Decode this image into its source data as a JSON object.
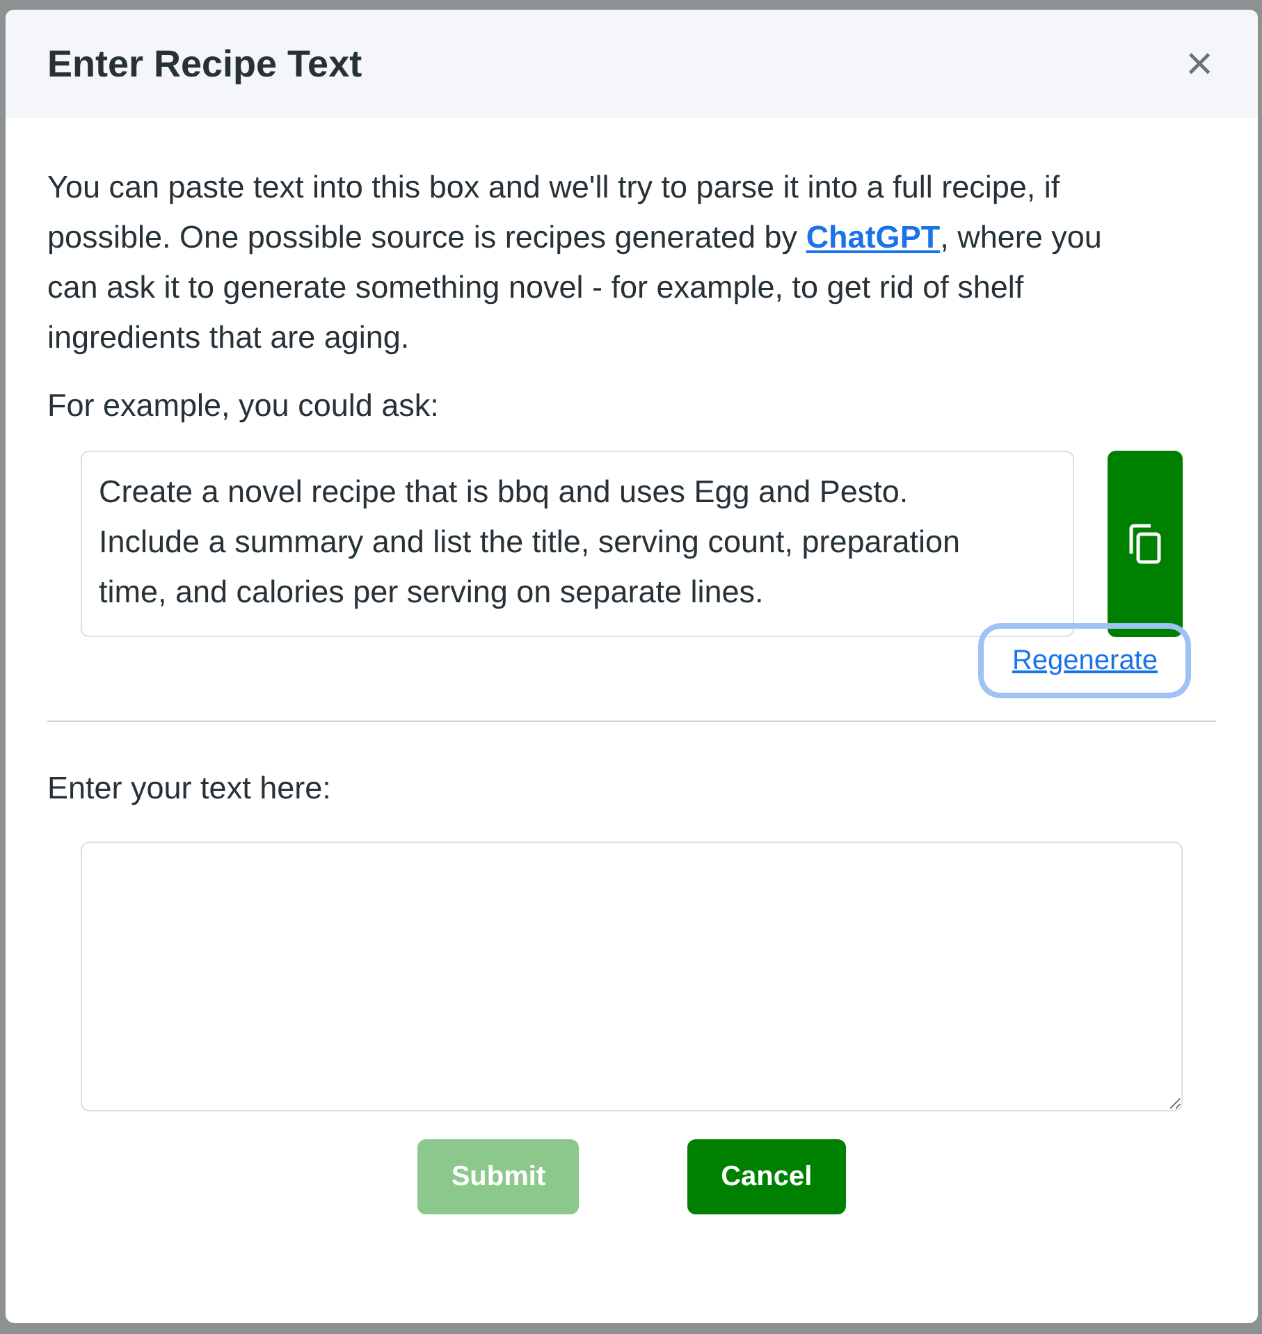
{
  "dialog": {
    "title": "Enter Recipe Text",
    "close": "×"
  },
  "intro": {
    "before": "You can paste text into this box and we'll try to parse it into a full recipe, if possible. One possible source is recipes generated by ",
    "link": "ChatGPT",
    "after": ", where you can ask it to generate something novel - for example, to get rid of shelf ingredients that are aging."
  },
  "example_label": "For example, you could ask:",
  "prompt_text": "Create a novel recipe that is bbq and uses Egg and Pesto. Include a summary and list the title, serving count, preparation time, and calories per serving on separate lines.",
  "regenerate": {
    "label": "Regenerate",
    "focused": true
  },
  "entry_label": "Enter your text here:",
  "buttons": [
    {
      "label": "Submit",
      "disabled": true
    },
    {
      "label": "Cancel",
      "disabled": false
    }
  ]
}
